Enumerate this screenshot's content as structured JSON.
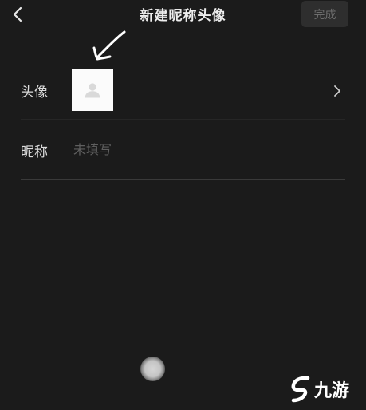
{
  "nav": {
    "title": "新建昵称头像",
    "done_label": "完成",
    "back_icon": "chevron-left-icon"
  },
  "rows": {
    "avatar": {
      "label": "头像",
      "placeholder_icon": "default-user-icon",
      "trailing_icon": "chevron-right-icon"
    },
    "nickname": {
      "label": "昵称",
      "placeholder": "未填写",
      "value": ""
    }
  },
  "overlay": {
    "annotation_icon": "hand-drawn-arrow-icon",
    "assistive_icon": "assistive-touch-dot-icon"
  },
  "watermark": {
    "text": "九游",
    "logo_icon": "jiuyou-logo-icon"
  },
  "colors": {
    "background": "#1b1b1b",
    "text_primary": "#ededed",
    "text_placeholder": "#5f5f5f",
    "button_disabled_bg": "#2e2e2e",
    "button_disabled_text": "#6d6d6d",
    "avatar_bg": "#fbfbfb",
    "divider": "#2f2f2f"
  }
}
